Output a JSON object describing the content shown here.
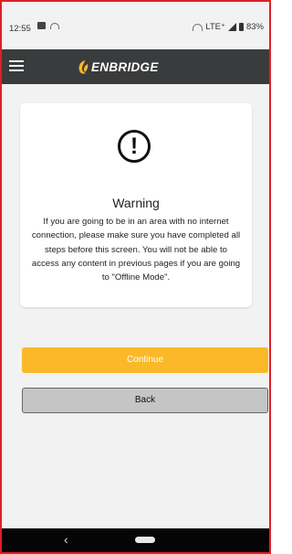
{
  "status_bar": {
    "time": "12:55",
    "network": "LTE⁺",
    "battery": "83%"
  },
  "app_bar": {
    "logo_text": "ENBRIDGE",
    "menu_icon": "hamburger-menu-icon"
  },
  "warning_card": {
    "icon": "exclamation-circle-icon",
    "title": "Warning",
    "message": "If you are going to be in an area with no internet connection, please make sure you have completed all steps before this screen.  You will not be able to access any content in previous pages if you are going to \"Offline Mode\"."
  },
  "buttons": {
    "continue_label": "Continue",
    "back_label": "Back"
  },
  "nav_bar": {
    "back_glyph": "‹"
  },
  "colors": {
    "accent": "#fbb829",
    "app_bar": "#3a3b3c",
    "back_button": "#c5c5c5",
    "background": "#f2f2f2",
    "frame_border": "#e31e24"
  }
}
